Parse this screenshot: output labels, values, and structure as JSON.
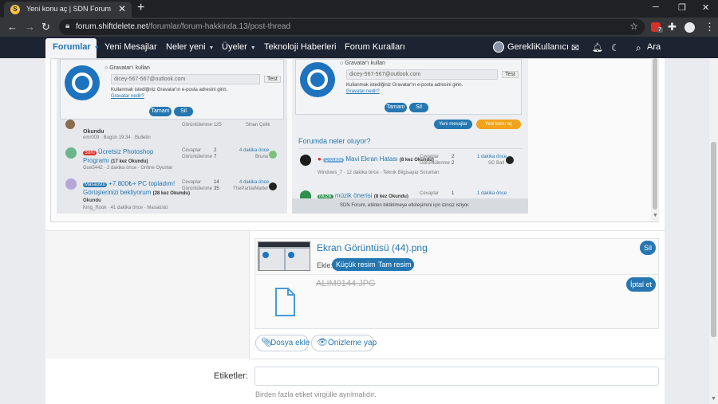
{
  "browser": {
    "tab_title": "Yeni konu aç | SDN Forum",
    "tab_close": "✕",
    "new_tab": "+",
    "url_host": "forum.shiftdelete.net",
    "url_path": "/forumlar/forum-hakkinda.13/post-thread",
    "ext_badge": "7"
  },
  "site_nav": {
    "items": [
      {
        "label": "Forumlar"
      },
      {
        "label": "Yeni Mesajlar"
      },
      {
        "label": "Neler yeni"
      },
      {
        "label": "Üyeler"
      },
      {
        "label": "Teknoloji Haberleri"
      },
      {
        "label": "Forum Kuralları"
      }
    ],
    "user": "GerekliKullanıcı",
    "search": "Ara"
  },
  "screenshot_preview": {
    "left": {
      "gravatar_label": "Gravatar'ı kullan",
      "email_value": "dicey-567-567@outlook.com",
      "test_btn": "Test",
      "hint": "Kullanmak istediğiniz Gravatar'ın e-posta adresini girin.",
      "link": "Gravatar nedir?",
      "ok_btn": "Tamam",
      "delete_btn": "Sil",
      "rows": [
        {
          "title": "Ücretsiz Photoshop",
          "title2": "Programı",
          "badge": "Soru",
          "suffix": "(17 kez Okundu)",
          "meta": "Gue5442 · 2 dakika önce · Online Oyunlar",
          "c1": "Cevaplar",
          "v1": "2",
          "c2": "Görüntülenme",
          "v2": "7",
          "t": "4 dakika önce",
          "u": "Bruna"
        },
        {
          "title": "+7.800₺+ PC topladım!",
          "title2": "Görüşlerinizi bekliyorum",
          "badge": "Masaüstü",
          "suffix": "(28 kez Okundu)",
          "meta": "King_Rook · 41 dakika önce · Masaüstü",
          "c1": "Cevaplar",
          "v1": "14",
          "c2": "Görüntülenme",
          "v2": "35",
          "t": "4 dakika önce",
          "u": "ThePartialMatter"
        }
      ],
      "top_row_meta": "emr009 · Bugün 19:34 · Bulletin",
      "top_row_t": "Okundu",
      "top_row_stats": "Görüntülenme 125",
      "top_row_user": "Sinan Çelik"
    },
    "right": {
      "gravatar_label": "Gravatar'ı kullan",
      "email_value": "dicey-567-567@outlook.com",
      "test_btn": "Test",
      "hint": "Kullanmak istediğiniz Gravatar'ın e-posta adresini girin.",
      "link": "Gravatar nedir?",
      "ok_btn": "Tamam",
      "delete_btn": "Sil",
      "new_msgs_btn": "Yeni mesajlar",
      "new_post_btn": "Yeni konu aç",
      "section_title": "Forumda neler oluyor?",
      "rows": [
        {
          "title": "Mavi Ekran Hatası",
          "badge": "Çözüldü",
          "suffix": "(8 kez Okundu)",
          "meta": "Windows_7 · 12 dakika önce · Teknik Bilgisayar Sorunları",
          "c1": "Cevaplar",
          "v1": "2",
          "c2": "Görüntülenme",
          "v2": "2",
          "t": "1 dakika önce",
          "u": "SC Ball"
        },
        {
          "title": "müzik önerisi",
          "badge": "Müzik",
          "suffix": "(8 kez Okundu)",
          "c1": "Cevaplar",
          "v1": "1",
          "t": "1 dakika önce"
        }
      ],
      "footer": "SDN Forum, etikten bildirilmeye etkileşimini için izinsiz istiyor."
    }
  },
  "attachment": {
    "filename": "Ekran Görüntüsü (44).png",
    "delete": "Sil",
    "insert_label": "Ekle:",
    "thumb_btn": "Küçük resim",
    "full_btn": "Tam resim",
    "uploading_name": "ALIM0144.JPG",
    "cancel": "İptal et"
  },
  "actions": {
    "attach_files": "Dosya ekle",
    "preview": "Önizleme yap"
  },
  "tags": {
    "label": "Etiketler:",
    "value": "",
    "hint": "Birden fazla etiket virgülle ayrılmalıdır."
  },
  "colors": {
    "accent": "#2577b1",
    "header_bg": "#1c2331"
  }
}
